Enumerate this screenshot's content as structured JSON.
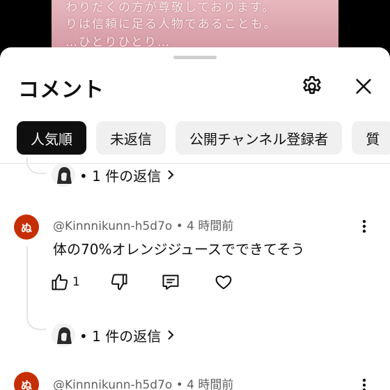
{
  "video": {
    "caption_lines": [
      "わりだくの方が尊敬しております。",
      "りは信頼に足る人物であることも。",
      "…ひとりひとり…"
    ]
  },
  "sheet": {
    "title": "コメント",
    "settings_icon": "gear-icon",
    "close_icon": "close-icon"
  },
  "chips": [
    {
      "label": "人気順",
      "active": true
    },
    {
      "label": "未返信",
      "active": false
    },
    {
      "label": "公開チャンネル登録者",
      "active": false
    },
    {
      "label": "質",
      "active": false
    }
  ],
  "thread_top": {
    "replies_label": "• 1 件の返信"
  },
  "comments": [
    {
      "avatar_text": "ぬ",
      "avatar_color": "#c62f05",
      "meta": "@Kinnnikunn-h5d7o • 4 時間前",
      "text": "体の70%オレンジジュースでできてそう",
      "likes": "1",
      "replies_label": "• 1 件の返信"
    },
    {
      "avatar_text": "ぬ",
      "avatar_color": "#c62f05",
      "meta": "@Kinnnikunn-h5d7o • 4 時間前"
    }
  ]
}
